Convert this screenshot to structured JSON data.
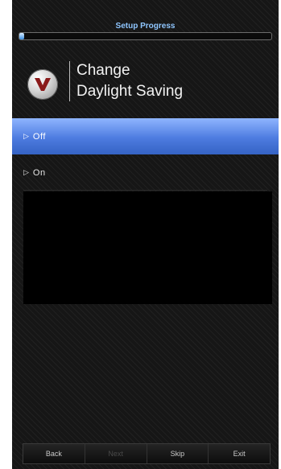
{
  "header": {
    "progress_label": "Setup Progress",
    "progress_value": 0.02
  },
  "title": {
    "line1": "Change",
    "line2": "Daylight Saving"
  },
  "menu": {
    "items": [
      {
        "label": "Off",
        "selected": true
      },
      {
        "label": "On",
        "selected": false
      }
    ]
  },
  "footer": {
    "buttons": [
      {
        "label": "Back",
        "enabled": true
      },
      {
        "label": "Next",
        "enabled": false
      },
      {
        "label": "Skip",
        "enabled": true
      },
      {
        "label": "Exit",
        "enabled": true
      }
    ]
  },
  "icons": {
    "logo": "vizio-v-logo",
    "menu_marker": "chevron-right-icon"
  },
  "colors": {
    "selection": "#4d7be0",
    "progress": "#3b8fe3",
    "label": "#8fc6ff"
  }
}
